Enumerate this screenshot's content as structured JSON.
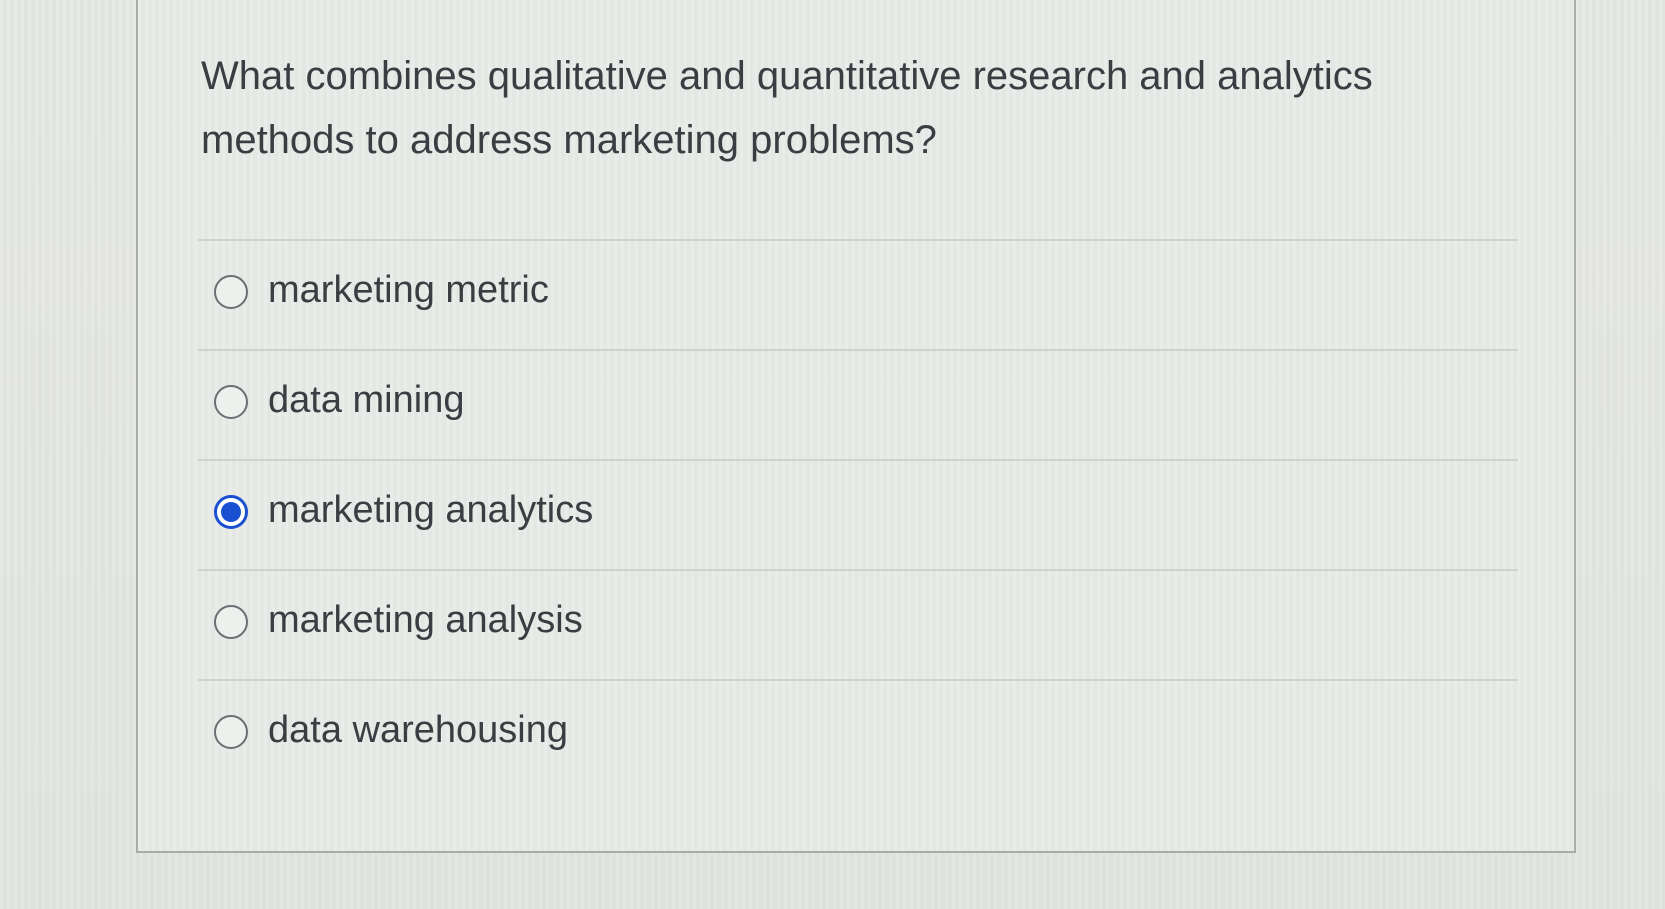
{
  "question": {
    "text": "What combines qualitative and quantitative research and analytics methods to address marketing problems?"
  },
  "options": [
    {
      "label": "marketing metric",
      "selected": false
    },
    {
      "label": "data mining",
      "selected": false
    },
    {
      "label": "marketing analytics",
      "selected": true
    },
    {
      "label": "marketing analysis",
      "selected": false
    },
    {
      "label": "data warehousing",
      "selected": false
    }
  ],
  "colors": {
    "accent": "#1a4fcf",
    "text": "#3a3d42",
    "divider": "#cfd3d0"
  }
}
